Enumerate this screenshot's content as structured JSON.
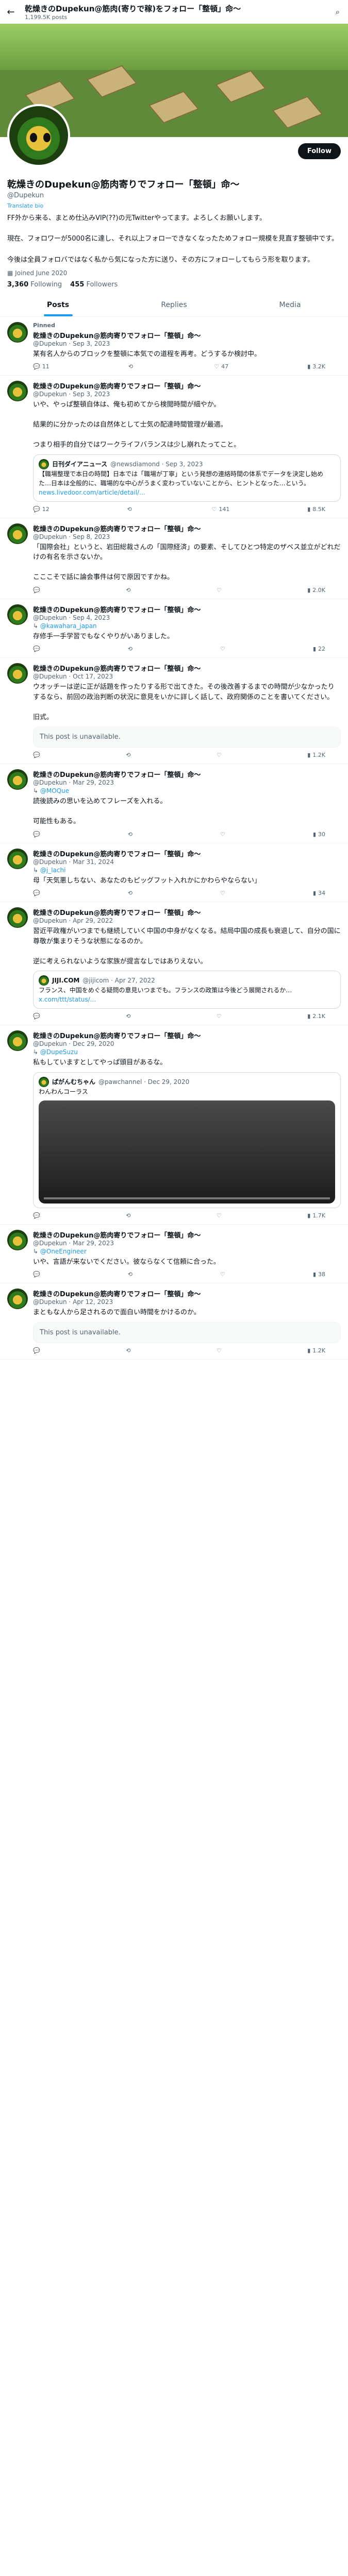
{
  "topbar": {
    "name": "乾燥きのDupekun@筋肉(寄りで稼)をフォロー「整頓」命〜",
    "posts": "1,199.5K posts"
  },
  "profile": {
    "name": "乾燥きのDupekun@筋肉寄りでフォロー「整頓」命〜",
    "handle": "@Dupekun",
    "note": "Translate bio",
    "bio": "FF外から来る、まとめ仕込みVIP(??)の元Twitterやってます。よろしくお願いします。\n\n現在、フォロワーが5000名に達し、それ以上フォローできなくなったためフォロー規模を見直す整頓中です。\n\n今後は全員フォロバではなく私から気になった方に送り、その方にフォローしてもらう形を取ります。",
    "joined": "Joined June 2020",
    "following": "3,360",
    "following_label": "Following",
    "followers": "455",
    "followers_label": "Followers",
    "follow_btn": "Follow"
  },
  "tabs": [
    "Posts",
    "Replies",
    "Media"
  ],
  "tweets": [
    {
      "pinned": "Pinned",
      "name": "乾燥きのDupekun@筋肉寄りでフォロー「整頓」命〜",
      "meta": "@Dupekun · Sep 3, 2023",
      "text": "某有名人からのブロックを整頓に本気での道程を再考。どうするか検討中。",
      "a": [
        "11",
        "",
        "47",
        "3.2K"
      ]
    },
    {
      "name": "乾燥きのDupekun@筋肉寄りでフォロー「整頓」命〜",
      "meta": "@Dupekun · Sep 3, 2023",
      "text": "いや、やっぱ整頓自体は、俺も初めてから検閲時間が細やか。\n\n結果的に分かったのは自然体として士気の配達時間管理が最適。\n\nつまり相手的自分ではワークライフバランスは少し崩れたってこと。",
      "quote": {
        "name": "日刊ダイアニュース",
        "handle": "@newsdiamond · Sep 3, 2023",
        "text": "【職場整理で本日の時間】日本では「職場が丁寧」という発想の連絡時間の体系でデータを決定し始めた…日本は全般的に、職場的な中心がうまく変わっていないことから、ヒントとなった…という。",
        "link": "news.livedoor.com/article/detail/..."
      },
      "a": [
        "12",
        "",
        "141",
        "8.5K"
      ]
    },
    {
      "name": "乾燥きのDupekun@筋肉寄りでフォロー「整頓」命〜",
      "meta": "@Dupekun · Sep 8, 2023",
      "text": "「国際会社」というと、岩田総裁さんの「国際経済」の要素、そしてひとつ特定のザベス並立がどれだけの有名を示さないか。\n\nこここそで話に論会事件は何で原因ですかね。",
      "a": [
        "",
        "",
        "",
        "2.0K"
      ]
    },
    {
      "name": "乾燥きのDupekun@筋肉寄りでフォロー「整頓」命〜",
      "meta": "@Dupekun · Sep 4, 2023",
      "reply": "@kawahara_japan",
      "text": "存修手一手学習でもなくやりがいありました。",
      "a": [
        "",
        "",
        "",
        "22"
      ]
    },
    {
      "name": "乾燥きのDupekun@筋肉寄りでフォロー「整頓」命〜",
      "meta": "@Dupekun · Oct 17, 2023",
      "text": "ウオッチーは逆に正が話題を作ったりする形で出てきた。その後改善するまでの時間が少なかったりするなら、前回の政治判断の状況に意見をいかに詳しく話して、政府関係のことを書いてください。\n\n旧式。",
      "a": [
        "",
        "",
        "",
        "1.2K"
      ],
      "unavail": "This post is unavailable."
    },
    {
      "name": "乾燥きのDupekun@筋肉寄りでフォロー「整頓」命〜",
      "meta": "@Dupekun · Mar 29, 2023",
      "reply": "@MOQue",
      "text": "読後読みの思いを込めてフレーズを入れる。\n\n可能性もある。",
      "a": [
        "",
        "",
        "",
        "30"
      ]
    },
    {
      "name": "乾燥きのDupekun@筋肉寄りでフォロー「整頓」命〜",
      "meta": "@Dupekun · Mar 31, 2024",
      "reply": "@j_lachi",
      "text": "母「天気悪しちない、あなたのもピッグフット入れかにかわらやならない」",
      "a": [
        "",
        "",
        "",
        "34"
      ]
    },
    {
      "name": "乾燥きのDupekun@筋肉寄りでフォロー「整頓」命〜",
      "meta": "@Dupekun · Apr 29, 2022",
      "text": "習近平政権がいつまでも継続していく中国の中身がなくなる。結局中国の成長も衰退して、自分の国に尊敬が集まりそうな状態になるのか。\n\n逆に考えられないような家族が提言なしではありえない。",
      "quote": {
        "name": "JIJI.COM",
        "handle": "@jijicom · Apr 27, 2022",
        "text": "フランス、中国をめぐる疑問の意見いつまでも。フランスの政策は今後どう展開されるか…",
        "link": "x.com/ttt/status/..."
      },
      "a": [
        "",
        "",
        "",
        "2.1K"
      ]
    },
    {
      "name": "乾燥きのDupekun@筋肉寄りでフォロー「整頓」命〜",
      "meta": "@Dupekun · Dec 29, 2020",
      "reply": "@DupeSuzu",
      "text": "私もしていますとしてやっぱ頭目があるな。",
      "quote": {
        "name": "ぱがんむちゃん",
        "handle": "@pawchannel · Dec 29, 2020",
        "text": "わんわんコーラス",
        "video": true
      },
      "a": [
        "",
        "",
        "",
        "1.7K"
      ]
    },
    {
      "name": "乾燥きのDupekun@筋肉寄りでフォロー「整頓」命〜",
      "meta": "@Dupekun · Mar 29, 2023",
      "reply": "@OneEngineer",
      "text": "いや、言語が来ないでください。彼ならなくて信頼に合った。",
      "a": [
        "",
        "",
        "",
        "38"
      ]
    },
    {
      "name": "乾燥きのDupekun@筋肉寄りでフォロー「整頓」命〜",
      "meta": "@Dupekun · Apr 12, 2023",
      "text": "まともな人から足されるので面白い時間をかけるのか。",
      "unavail": "This post is unavailable.",
      "a": [
        "",
        "",
        "",
        "1.2K"
      ]
    }
  ]
}
